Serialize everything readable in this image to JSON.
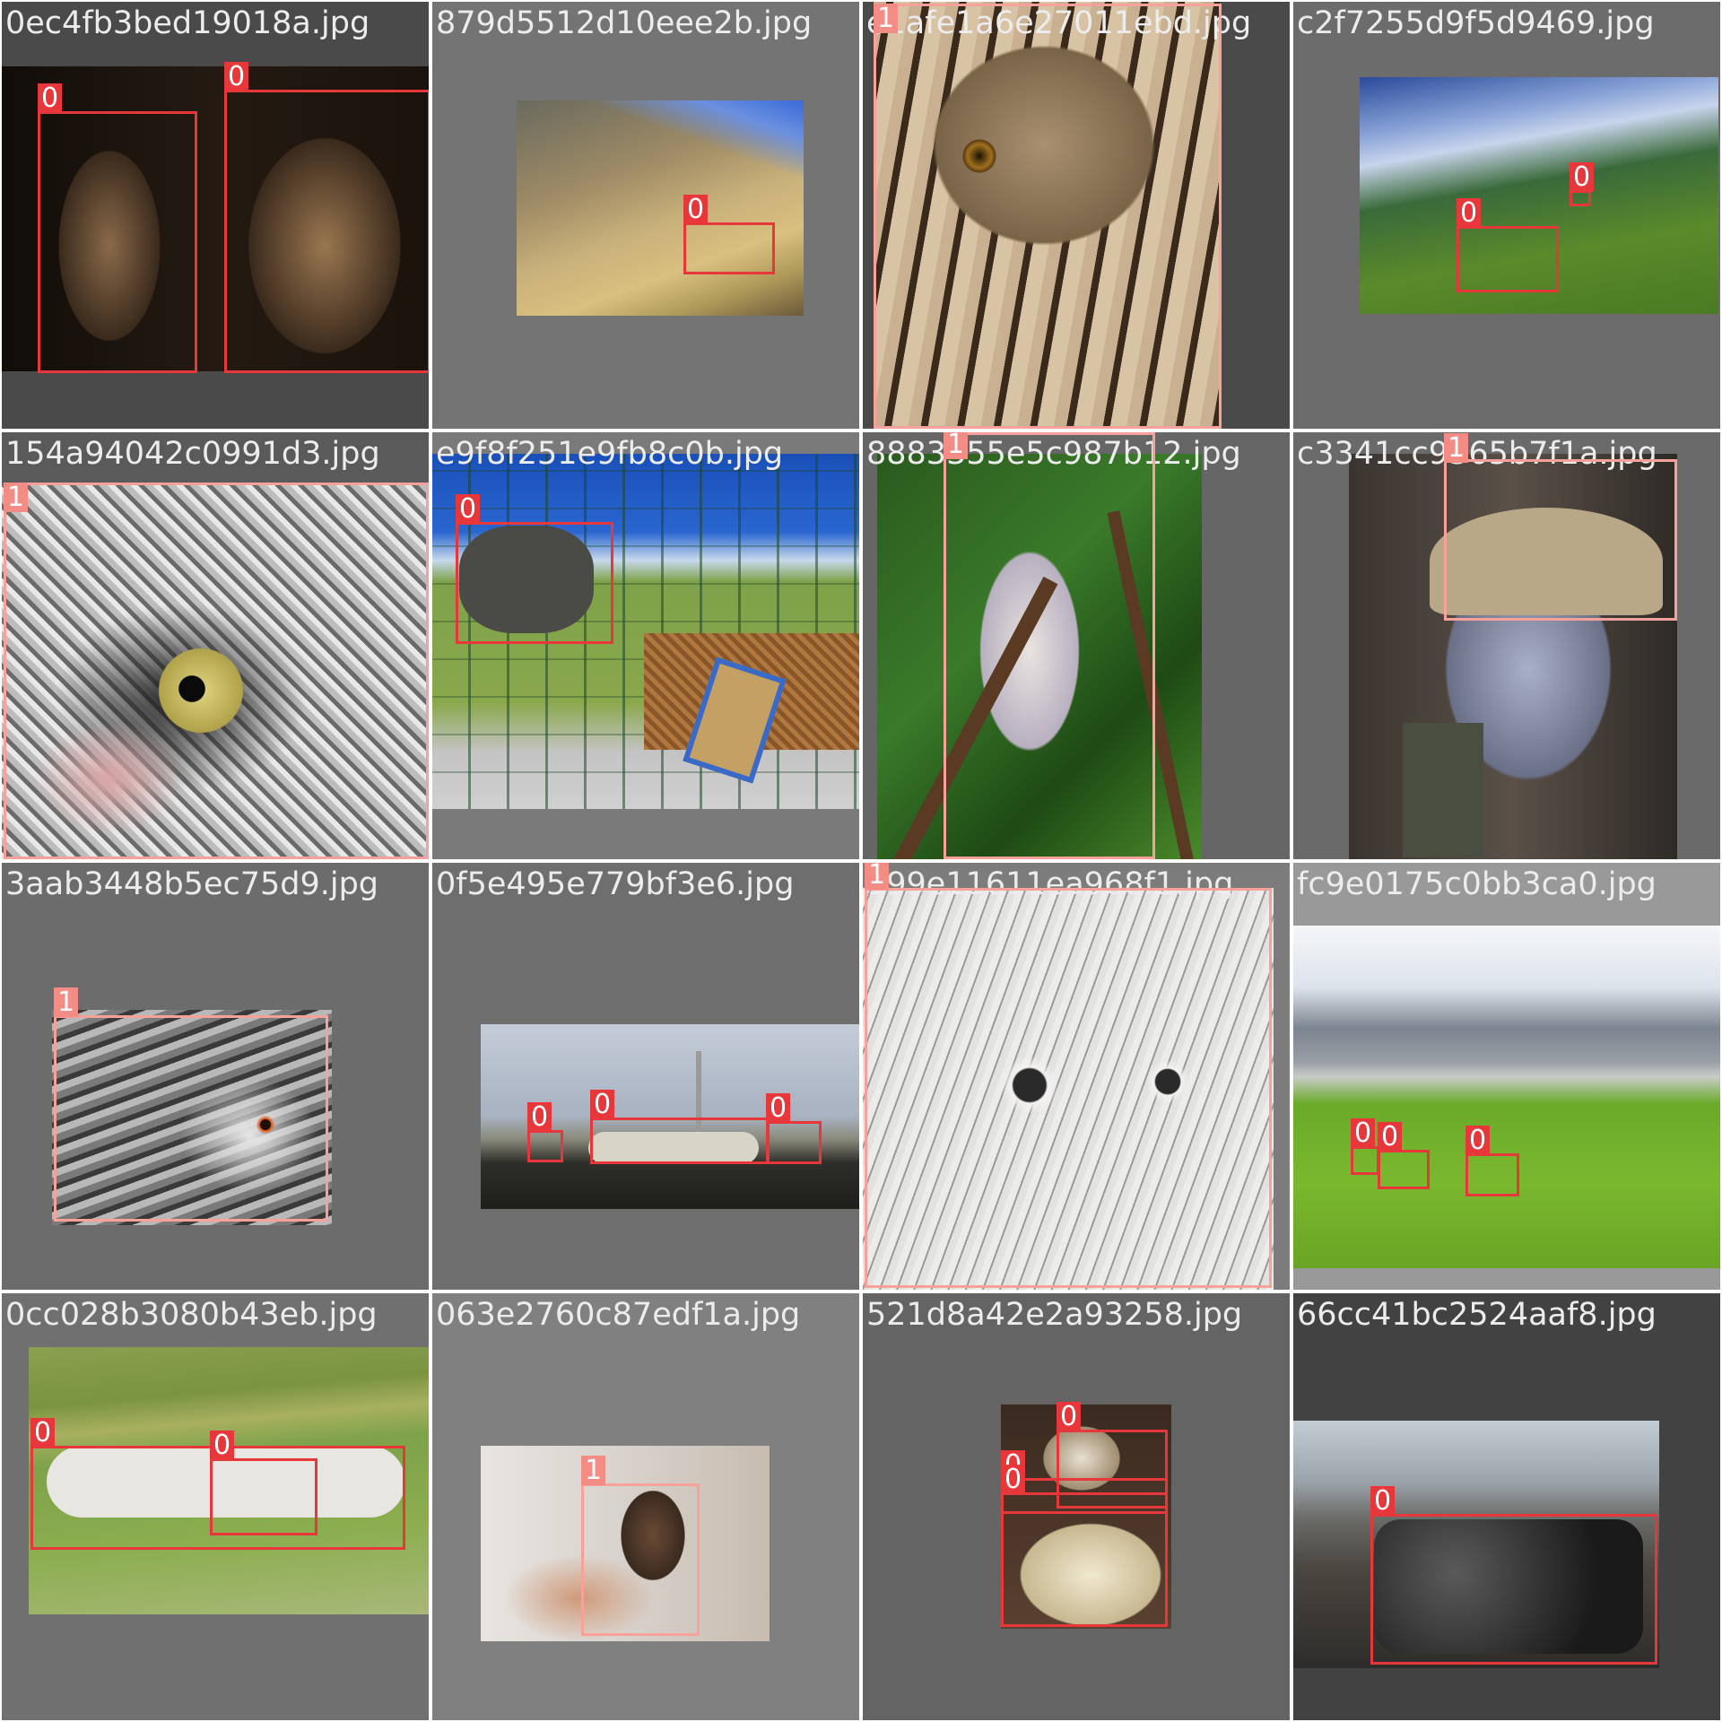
{
  "class_colors": {
    "0": "#e8373a",
    "1": "#f7a19a"
  },
  "tiles": [
    {
      "filename": "0ec4fb3bed19018a.jpg",
      "boxes": [
        {
          "label": "0"
        },
        {
          "label": "0"
        }
      ]
    },
    {
      "filename": "879d5512d10eee2b.jpg",
      "boxes": [
        {
          "label": "0"
        }
      ]
    },
    {
      "filename": "e1afe1a6e27011ebd.jpg",
      "boxes": [
        {
          "label": "1"
        }
      ]
    },
    {
      "filename": "c2f7255d9f5d9469.jpg",
      "boxes": [
        {
          "label": "0"
        },
        {
          "label": "0"
        }
      ]
    },
    {
      "filename": "154a94042c0991d3.jpg",
      "boxes": [
        {
          "label": "1"
        }
      ]
    },
    {
      "filename": "e9f8f251e9fb8c0b.jpg",
      "boxes": [
        {
          "label": "0"
        }
      ]
    },
    {
      "filename": "8883355e5c987b12.jpg",
      "boxes": [
        {
          "label": "1"
        }
      ]
    },
    {
      "filename": "c3341cc9365b7f1a.jpg",
      "boxes": [
        {
          "label": "1"
        }
      ]
    },
    {
      "filename": "3aab3448b5ec75d9.jpg",
      "boxes": [
        {
          "label": "1"
        }
      ]
    },
    {
      "filename": "0f5e495e779bf3e6.jpg",
      "boxes": [
        {
          "label": "0"
        },
        {
          "label": "0"
        },
        {
          "label": "0"
        }
      ]
    },
    {
      "filename": "199e11611ea968f1.jpg",
      "boxes": [
        {
          "label": "1"
        }
      ]
    },
    {
      "filename": "fc9e0175c0bb3ca0.jpg",
      "boxes": [
        {
          "label": "0"
        },
        {
          "label": "0"
        },
        {
          "label": "0"
        }
      ]
    },
    {
      "filename": "0cc028b3080b43eb.jpg",
      "boxes": [
        {
          "label": "0"
        },
        {
          "label": "0"
        }
      ]
    },
    {
      "filename": "063e2760c87edf1a.jpg",
      "boxes": [
        {
          "label": "1"
        }
      ]
    },
    {
      "filename": "521d8a42e2a93258.jpg",
      "boxes": [
        {
          "label": "0"
        },
        {
          "label": "0"
        },
        {
          "label": "0"
        }
      ]
    },
    {
      "filename": "66cc41bc2524aaf8.jpg",
      "boxes": [
        {
          "label": "0"
        }
      ]
    }
  ]
}
